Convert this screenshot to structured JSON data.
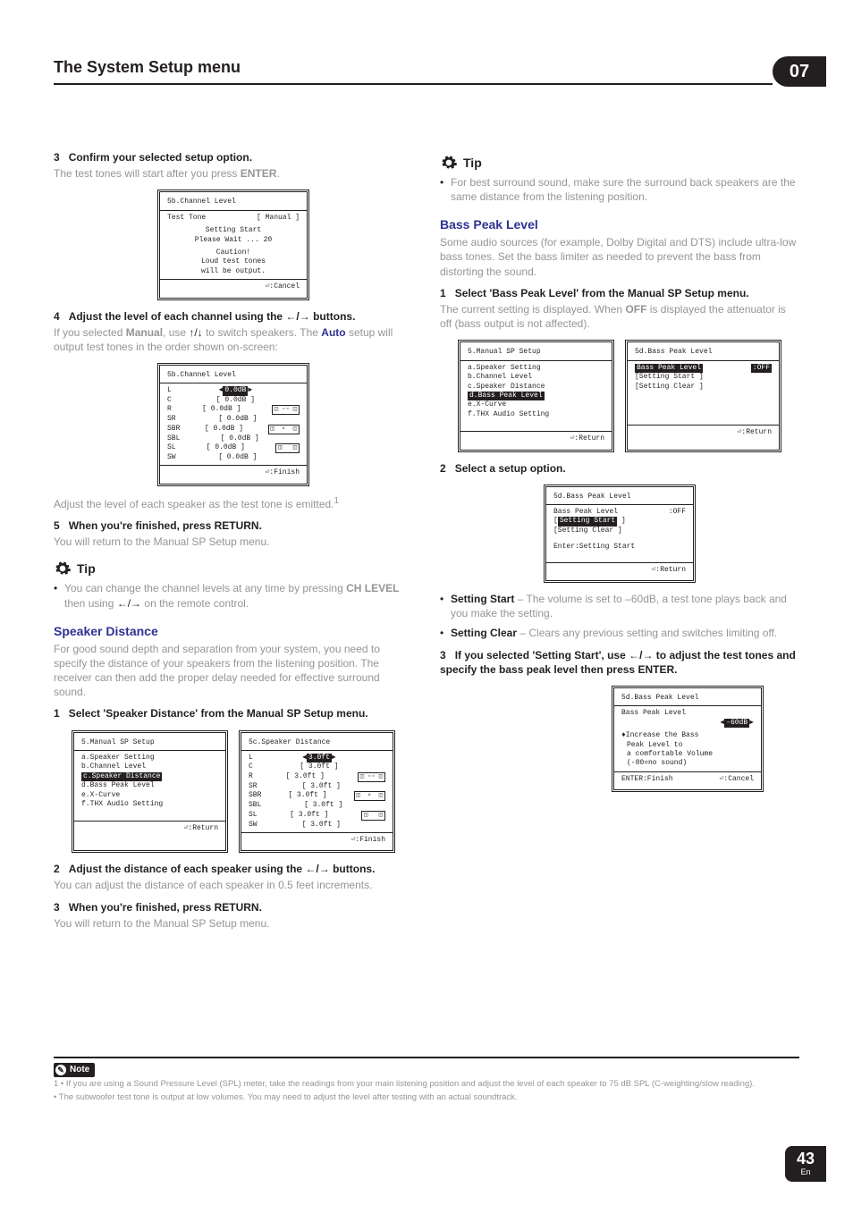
{
  "header": {
    "title": "The System Setup menu",
    "badge": "07"
  },
  "left": {
    "s3": {
      "num": "3",
      "title": "Confirm your selected setup option.",
      "body_a": "The test tones will start after you press ",
      "enter": "ENTER",
      "body_b": "."
    },
    "lcd1": {
      "title": "5b.Channel Level",
      "l1a": "Test Tone",
      "l1b": "[ Manual ]",
      "l2": "Setting Start",
      "l3": "Please Wait ...    20",
      "l4": "Caution!",
      "l5": "Loud test tones",
      "l6": "will be output.",
      "footer": "⏎:Cancel"
    },
    "s4": {
      "num": "4",
      "title_a": "Adjust the level of each channel using the ",
      "arrows": "←/→",
      "title_b": " buttons."
    },
    "s4body": {
      "a": "If you selected ",
      "manual": "Manual",
      "b": ", use ",
      "ud": "↑/↓",
      "c": " to switch speakers. The ",
      "auto": "Auto",
      "d": " setup will output test tones in the order shown on-screen:"
    },
    "lcd2": {
      "title": "5b.Channel Level",
      "rows": [
        [
          "L",
          "0.0dB",
          ""
        ],
        [
          "C",
          "0.0dB",
          ""
        ],
        [
          "R",
          "0.0dB",
          "◫ ▫▫ ◫"
        ],
        [
          "SR",
          "0.0dB",
          ""
        ],
        [
          "SBR",
          "0.0dB",
          "◫  ∘  ◫"
        ],
        [
          "SBL",
          "0.0dB",
          ""
        ],
        [
          "SL",
          "0.0dB",
          "◫   ◫"
        ],
        [
          "SW",
          "0.0dB",
          ""
        ]
      ],
      "footer": "⏎:Finish"
    },
    "afterlcd2": {
      "a": "Adjust the level of each speaker as the test tone is emitted.",
      "sup": "1"
    },
    "s5": {
      "num": "5",
      "title": "When you're finished, press RETURN.",
      "body": "You will return to the Manual SP Setup menu."
    },
    "tip": {
      "label": "Tip",
      "bullet_a": "You can change the channel levels at any time by pressing ",
      "chlevel": "CH LEVEL",
      "bullet_b": " then using ",
      "arrows": "←/→",
      "bullet_c": " on the remote control."
    },
    "spk": {
      "h": "Speaker Distance",
      "para": "For good sound depth and separation from your system, you need to specify the distance of your speakers from the listening position. The receiver can then add the proper delay needed for effective surround sound."
    },
    "s1b": {
      "num": "1",
      "title": "Select 'Speaker Distance' from the Manual SP Setup menu."
    },
    "lcd3a": {
      "title": "5.Manual SP Setup",
      "items": [
        "a.Speaker Setting",
        "b.Channel Level",
        "c.Speaker Distance",
        "d.Bass Peak Level",
        "e.X-Curve",
        "f.THX Audio Setting"
      ],
      "hi": 2,
      "footer": "⏎:Return"
    },
    "lcd3b": {
      "title": "5c.Speaker Distance",
      "rows": [
        [
          "L",
          "3.0ft",
          ""
        ],
        [
          "C",
          "3.0ft",
          ""
        ],
        [
          "R",
          "3.0ft",
          "◫ ▫▫ ◫"
        ],
        [
          "SR",
          "3.0ft",
          ""
        ],
        [
          "SBR",
          "3.0ft",
          "◫  ∘  ◫"
        ],
        [
          "SBL",
          "3.0ft",
          ""
        ],
        [
          "SL",
          "3.0ft",
          "◫   ◫"
        ],
        [
          "SW",
          "3.0ft",
          ""
        ]
      ],
      "footer": "⏎:Finish"
    },
    "s2b": {
      "num": "2",
      "title_a": "Adjust the distance of each speaker using the ",
      "arrows": "←/→",
      "title_b": " buttons.",
      "body": "You can adjust the distance of each speaker in 0.5 feet increments."
    },
    "s3b": {
      "num": "3",
      "title": "When you're finished, press RETURN.",
      "body": "You will return to the Manual SP Setup menu."
    }
  },
  "right": {
    "tip": {
      "label": "Tip",
      "bullet": "For best surround sound, make sure the surround back speakers are the same distance from the listening position."
    },
    "bass": {
      "h": "Bass Peak Level",
      "para": "Some audio sources (for example, Dolby Digital and DTS) include ultra-low bass tones. Set the bass limiter as needed to prevent the bass from distorting the sound."
    },
    "s1": {
      "num": "1",
      "title": "Select 'Bass Peak Level' from the Manual SP Setup menu.",
      "body_a": "The current setting is displayed. When ",
      "off": "OFF",
      "body_b": " is displayed the attenuator is off (bass output is not affected)."
    },
    "lcd4a": {
      "title": "5.Manual SP Setup",
      "items": [
        "a.Speaker Setting",
        "b.Channel Level",
        "c.Speaker Distance",
        "d.Bass Peak Level",
        "e.X-Curve",
        "f.THX Audio Setting"
      ],
      "hi": 3,
      "footer": "⏎:Return"
    },
    "lcd4b": {
      "title": "5d.Bass Peak Level",
      "l1a": "Bass Peak Level",
      "l1b": ":OFF",
      "l2": "[Setting Start       ]",
      "l3": "[Setting Clear       ]",
      "footer": "⏎:Return"
    },
    "s2": {
      "num": "2",
      "title": "Select a setup option."
    },
    "lcd5": {
      "title": "5d.Bass Peak Level",
      "l1a": "Bass Peak Level",
      "l1b": ":OFF",
      "l2": "Setting Start",
      "l3": "[Setting Clear       ]",
      "l4": "Enter:Setting Start",
      "footer": "⏎:Return"
    },
    "opts": [
      {
        "lead": "Setting Start",
        "rest": " – The volume is set to –60dB, a test tone plays back and you make the setting."
      },
      {
        "lead": "Setting Clear",
        "rest": " – Clears any previous setting and switches limiting off."
      }
    ],
    "s3": {
      "num": "3",
      "title_a": "If you selected 'Setting Start', use ",
      "arrows": "←/→",
      "title_b": " to adjust the test tones and specify the bass peak level then press ENTER."
    },
    "lcd6": {
      "title": "5d.Bass Peak Level",
      "l1": "Bass Peak Level",
      "val": "-60dB",
      "l2": "♦Increase the Bass",
      "l3": "Peak Level to",
      "l4": "a comfortable Volume",
      "l5": "(-80=no sound)",
      "footer_a": "ENTER:Finish",
      "footer_b": "⏎:Cancel"
    }
  },
  "footnote": {
    "label": "Note",
    "l1": "1 • If you are using a Sound Pressure Level (SPL) meter, take the readings from your main listening position and adjust the level of each speaker to 75 dB SPL (C-weighting/slow reading).",
    "l2": "• The subwoofer test tone is output at low volumes. You may need to adjust the level after testing with an actual soundtrack."
  },
  "pagenum": {
    "big": "43",
    "sm": "En"
  }
}
